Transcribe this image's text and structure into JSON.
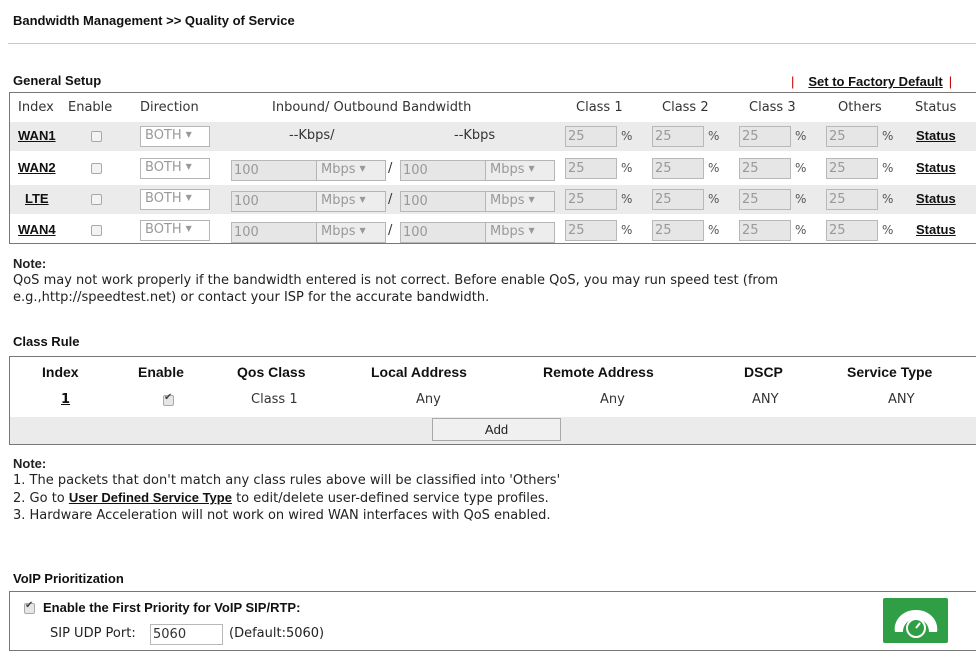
{
  "page": {
    "title": "Bandwidth Management >> Quality of Service"
  },
  "general": {
    "title": "General Setup",
    "factory_sep": "|",
    "factory_link": "Set to Factory Default",
    "headers": {
      "index": "Index",
      "enable": "Enable",
      "direction": "Direction",
      "bandwidth": "Inbound/ Outbound Bandwidth",
      "class1": "Class 1",
      "class2": "Class 2",
      "class3": "Class 3",
      "others": "Others",
      "status": "Status"
    },
    "rows": [
      {
        "name": "WAN1",
        "enabled": false,
        "direction": "BOTH",
        "inbound_text": "--Kbps/",
        "outbound_text": "--Kbps",
        "class1": "25",
        "class2": "25",
        "class3": "25",
        "others": "25",
        "status": "Status"
      },
      {
        "name": "WAN2",
        "enabled": false,
        "direction": "BOTH",
        "inbound": "100",
        "inbound_unit": "Mbps",
        "outbound": "100",
        "outbound_unit": "Mbps",
        "class1": "25",
        "class2": "25",
        "class3": "25",
        "others": "25",
        "status": "Status"
      },
      {
        "name": "LTE",
        "enabled": false,
        "direction": "BOTH",
        "inbound": "100",
        "inbound_unit": "Mbps",
        "outbound": "100",
        "outbound_unit": "Mbps",
        "class1": "25",
        "class2": "25",
        "class3": "25",
        "others": "25",
        "status": "Status"
      },
      {
        "name": "WAN4",
        "enabled": false,
        "direction": "BOTH",
        "inbound": "100",
        "inbound_unit": "Mbps",
        "outbound": "100",
        "outbound_unit": "Mbps",
        "class1": "25",
        "class2": "25",
        "class3": "25",
        "others": "25",
        "status": "Status"
      }
    ],
    "pct": "%",
    "slash": "/",
    "note_title": "Note:",
    "note_line1": "QoS may not work properly if the bandwidth entered is not correct. Before enable QoS, you may run speed test (from",
    "note_line2": "e.g.,http://speedtest.net) or contact your ISP for the accurate bandwidth."
  },
  "class_rule": {
    "title": "Class Rule",
    "headers": {
      "index": "Index",
      "enable": "Enable",
      "qos_class": "Qos Class",
      "local": "Local Address",
      "remote": "Remote Address",
      "dscp": "DSCP",
      "service": "Service Type"
    },
    "rows": [
      {
        "index": "1",
        "enabled": true,
        "qos_class": "Class 1",
        "local": "Any",
        "remote": "Any",
        "dscp": "ANY",
        "service": "ANY"
      }
    ],
    "add_button": "Add",
    "note_title": "Note:",
    "note1": "1. The packets that don't match any class rules above will be classified into 'Others'",
    "note2_pre": "2. Go to ",
    "note2_link": "User Defined Service Type",
    "note2_post": " to edit/delete user-defined service type profiles.",
    "note3": "3. Hardware Acceleration will not work on wired WAN interfaces with QoS enabled."
  },
  "voip": {
    "title": "VoIP Prioritization",
    "enable_label": "Enable the First Priority for VoIP SIP/RTP:",
    "enabled": true,
    "sip_label": "SIP UDP Port:",
    "sip_value": "5060",
    "sip_default": "(Default:5060)",
    "logo_icon": "voip-phone-icon",
    "logo_color": "#2f9e45"
  }
}
